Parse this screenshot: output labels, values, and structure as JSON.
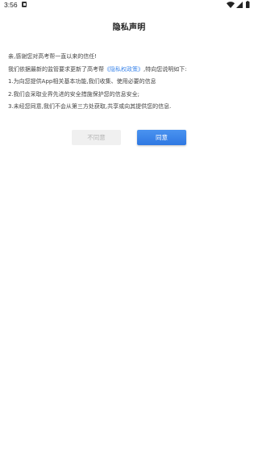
{
  "status_bar": {
    "time": "3:56",
    "icons": [
      "notification-icon",
      "wifi-icon",
      "cell-signal-icon",
      "battery-icon"
    ]
  },
  "dialog": {
    "title": "隐私声明",
    "lines": {
      "l1": "亲,感谢您对高考帮一直以来的信任!",
      "l2_prefix": "我们依据最新的监管要求更新了高考帮",
      "l2_link": "《隐私权政策》",
      "l2_suffix": ",特向您说明如下:",
      "l3": "1.为向您提供App相关基本功能,我们收集、使用必要的信息",
      "l4": "2.我们会采取业界先进的安全措施保护您的信息安全;",
      "l5": "3.未经您同意,我们不会从第三方处获取,共享或向其提供您的信息."
    },
    "disagree_label": "不同意",
    "agree_label": "同意"
  },
  "colors": {
    "link": "#3d86ea",
    "agree_button": "#3a82ea",
    "disagree_button": "#f0f0f0"
  }
}
